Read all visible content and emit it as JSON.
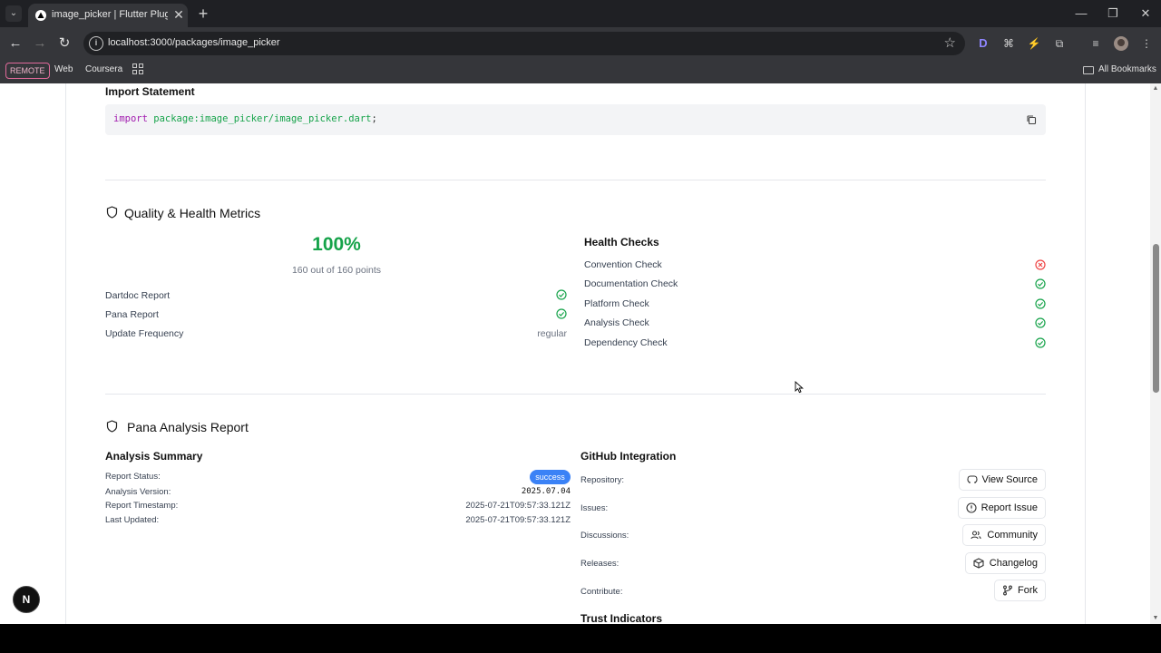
{
  "browser": {
    "tab_title": "image_picker | Flutter Plugin | Co",
    "tab_close": "✕",
    "new_tab": "+",
    "url": "localhost:3000/packages/image_picker",
    "bookmarks": {
      "remote": "REMOTE",
      "web": "Web",
      "coursera": "Coursera",
      "all_bookmarks": "All Bookmarks"
    }
  },
  "import_section": {
    "heading": "Import Statement",
    "keyword": "import",
    "path": "package:image_picker/image_picker.dart",
    "terminator": ";"
  },
  "quality": {
    "title": "Quality & Health Metrics",
    "score": "100%",
    "points": "160 out of 160 points",
    "metrics": [
      {
        "label": "Dartdoc Report",
        "status": "pass"
      },
      {
        "label": "Pana Report",
        "status": "pass"
      },
      {
        "label": "Update Frequency",
        "value": "regular"
      }
    ],
    "health_heading": "Health Checks",
    "health_checks": [
      {
        "label": "Convention Check",
        "status": "fail"
      },
      {
        "label": "Documentation Check",
        "status": "pass"
      },
      {
        "label": "Platform Check",
        "status": "pass"
      },
      {
        "label": "Analysis Check",
        "status": "pass"
      },
      {
        "label": "Dependency Check",
        "status": "pass"
      }
    ]
  },
  "pana": {
    "title": "Pana Analysis Report",
    "summary_heading": "Analysis Summary",
    "summary": [
      {
        "label": "Report Status:",
        "value": "success"
      },
      {
        "label": "Analysis Version:",
        "value": "2025.07.04"
      },
      {
        "label": "Report Timestamp:",
        "value": "2025-07-21T09:57:33.121Z"
      },
      {
        "label": "Last Updated:",
        "value": "2025-07-21T09:57:33.121Z"
      }
    ],
    "github_heading": "GitHub Integration",
    "github": [
      {
        "label": "Repository:",
        "button": "View Source",
        "icon": "github-icon"
      },
      {
        "label": "Issues:",
        "button": "Report Issue",
        "icon": "alert-circle-icon"
      },
      {
        "label": "Discussions:",
        "button": "Community",
        "icon": "users-icon"
      },
      {
        "label": "Releases:",
        "button": "Changelog",
        "icon": "package-icon"
      },
      {
        "label": "Contribute:",
        "button": "Fork",
        "icon": "git-fork-icon"
      }
    ],
    "trust_heading": "Trust Indicators"
  },
  "dev_badge": "N",
  "colors": {
    "accent_green": "#16a34a",
    "fail_red": "#ef4444",
    "badge_blue": "#3b82f6",
    "code_keyword": "#a21caf"
  }
}
